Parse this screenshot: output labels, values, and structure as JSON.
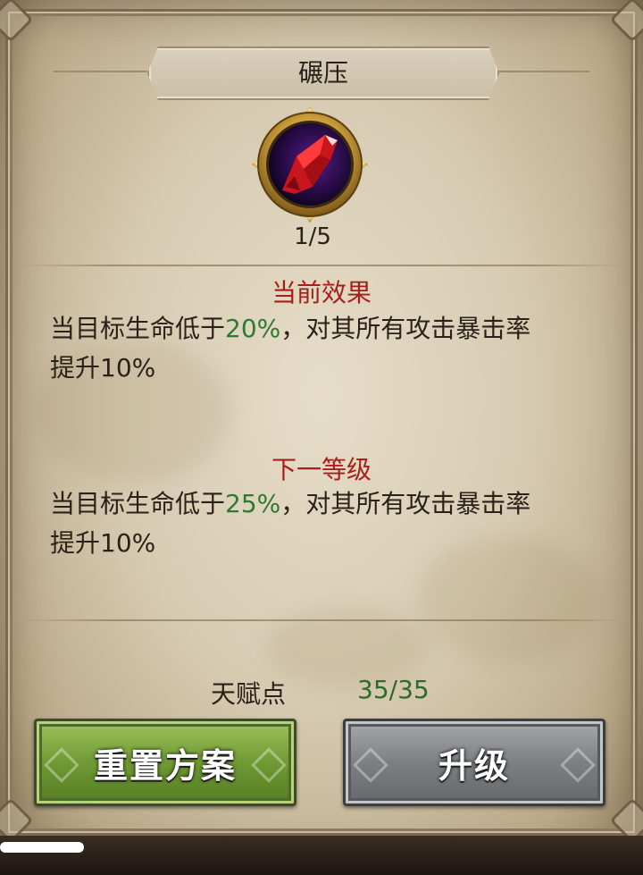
{
  "skill": {
    "name": "碾压",
    "icon": "crystal-shard-icon",
    "level": "1/5"
  },
  "current_effect": {
    "title": "当前效果",
    "prefix": "当目标生命低于",
    "value": "20%",
    "suffix": "，对其所有攻击暴击率",
    "line2": "提升10%"
  },
  "next_level": {
    "title": "下一等级",
    "prefix": "当目标生命低于",
    "value": "25%",
    "suffix": "，对其所有攻击暴击率",
    "line2": "提升10%"
  },
  "talent_points": {
    "label": "天赋点",
    "value": "35/35"
  },
  "buttons": {
    "reset_label": "重置方案",
    "upgrade_label": "升级"
  },
  "colors": {
    "effect_title": "#a5201a",
    "value_green": "#2e7a2e",
    "reset_button": "#6f9a34",
    "upgrade_button": "#7d7f82"
  }
}
